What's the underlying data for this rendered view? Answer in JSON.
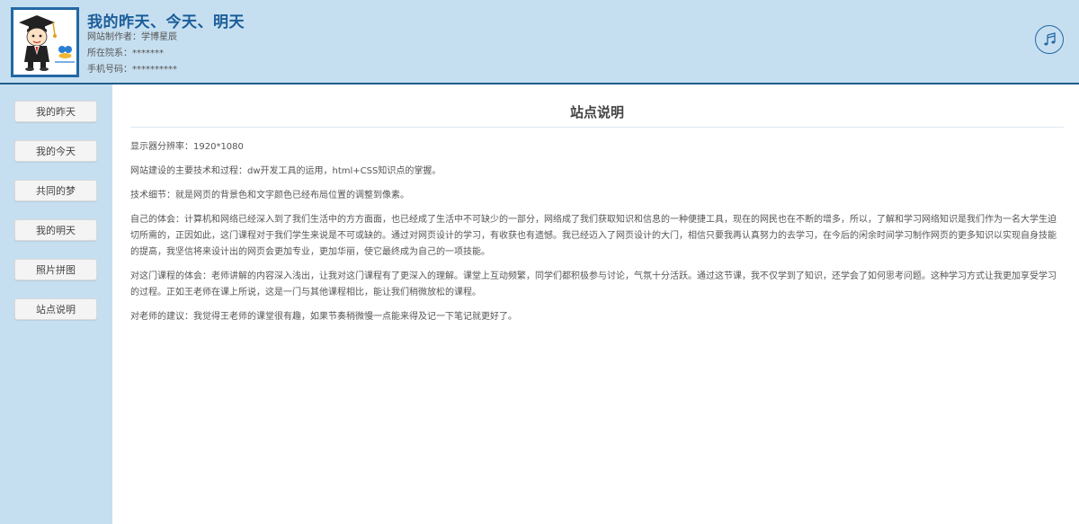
{
  "header": {
    "title": "我的昨天、今天、明天",
    "author": "网站制作者：学博星辰",
    "department": "所在院系：*******",
    "phone": "手机号码：**********"
  },
  "sidebar": {
    "items": [
      {
        "label": "我的昨天"
      },
      {
        "label": "我的今天"
      },
      {
        "label": "共同的梦"
      },
      {
        "label": "我的明天"
      },
      {
        "label": "照片拼图"
      },
      {
        "label": "站点说明"
      }
    ]
  },
  "main": {
    "title": "站点说明",
    "paragraphs": [
      "显示器分辨率：1920*1080",
      "网站建设的主要技术和过程：dw开发工具的运用，html+CSS知识点的掌握。",
      "技术细节：就是网页的背景色和文字颜色已经布局位置的调整到像素。",
      "自己的体会：计算机和网络已经深入到了我们生活中的方方面面，也已经成了生活中不可缺少的一部分，网络成了我们获取知识和信息的一种便捷工具，现在的网民也在不断的增多，所以，了解和学习网络知识是我们作为一名大学生迫切所需的，正因如此，这门课程对于我们学生来说是不可或缺的。通过对网页设计的学习，有收获也有遗憾。我已经迈入了网页设计的大门，相信只要我再认真努力的去学习，在今后的闲余时间学习制作网页的更多知识以实现自身技能的提高，我坚信将来设计出的网页会更加专业，更加华丽，使它最终成为自己的一项技能。",
      "对这门课程的体会：老师讲解的内容深入浅出，让我对这门课程有了更深入的理解。课堂上互动频繁，同学们都积极参与讨论，气氛十分活跃。通过这节课，我不仅学到了知识，还学会了如何思考问题。这种学习方式让我更加享受学习的过程。正如王老师在课上所说，这是一门与其他课程相比，能让我们稍微放松的课程。",
      "对老师的建议：我觉得王老师的课堂很有趣，如果节奏稍微慢一点能来得及记一下笔记就更好了。"
    ]
  },
  "icons": {
    "avatar": "graduate-cartoon-avatar",
    "music": "music-note-icon"
  },
  "colors": {
    "header_bg": "#c6dff0",
    "accent": "#1c5d9a",
    "border": "#1e5d8c"
  }
}
